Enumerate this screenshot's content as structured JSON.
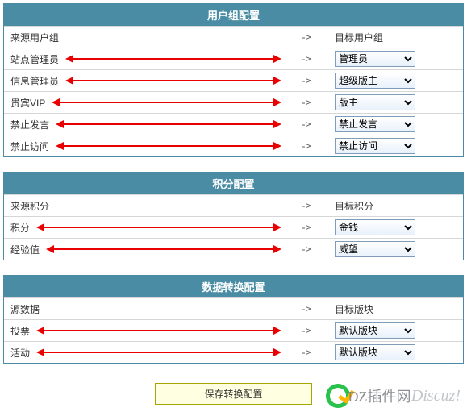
{
  "sections": [
    {
      "title": "用户组配置",
      "header_left": "来源用户组",
      "arrow_symbol": "->",
      "header_right": "目标用户组",
      "rows": [
        {
          "left": "站点管理员",
          "right": "管理员"
        },
        {
          "left": "信息管理员",
          "right": "超级版主"
        },
        {
          "left": "贵宾VIP",
          "right": "版主"
        },
        {
          "left": "禁止发言",
          "right": "禁止发言"
        },
        {
          "left": "禁止访问",
          "right": "禁止访问"
        }
      ]
    },
    {
      "title": "积分配置",
      "header_left": "来源积分",
      "arrow_symbol": "->",
      "header_right": "目标积分",
      "rows": [
        {
          "left": "积分",
          "right": "金钱"
        },
        {
          "left": "经验值",
          "right": "威望"
        }
      ]
    },
    {
      "title": "数据转换配置",
      "header_left": "源数据",
      "arrow_symbol": "->",
      "header_right": "目标版块",
      "rows": [
        {
          "left": "投票",
          "right": "默认版块"
        },
        {
          "left": "活动",
          "right": "默认版块"
        }
      ]
    }
  ],
  "save_button": "保存转换配置",
  "watermark": {
    "brand1": "DZ插件网",
    "brand2": "Discuz!"
  }
}
